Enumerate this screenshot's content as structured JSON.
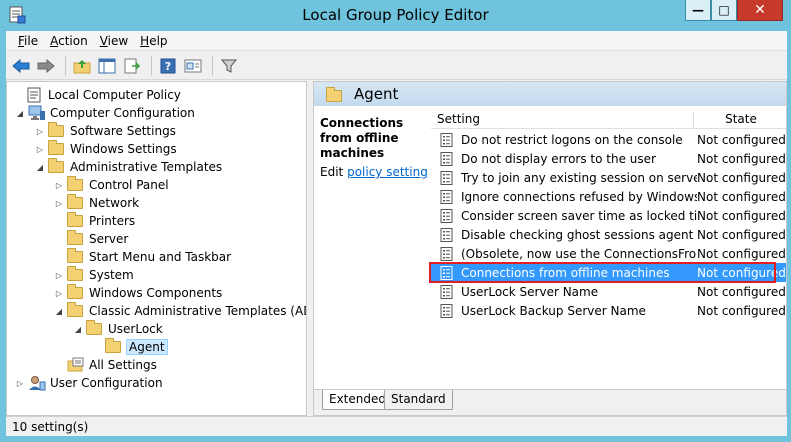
{
  "window": {
    "title": "Local Group Policy Editor"
  },
  "menu": [
    {
      "key": "F",
      "rest": "ile"
    },
    {
      "key": "A",
      "rest": "ction"
    },
    {
      "key": "V",
      "rest": "iew"
    },
    {
      "key": "H",
      "rest": "elp"
    }
  ],
  "tree": [
    {
      "label": "Local Computer Policy",
      "level": 0,
      "icon": "policy-icon",
      "exp": ""
    },
    {
      "label": "Computer Configuration",
      "level": 1,
      "icon": "computer-icon",
      "exp": "expanded"
    },
    {
      "label": "Software Settings",
      "level": 2,
      "icon": "folder-icon",
      "exp": "collapsed"
    },
    {
      "label": "Windows Settings",
      "level": 2,
      "icon": "folder-icon",
      "exp": "collapsed"
    },
    {
      "label": "Administrative Templates",
      "level": 2,
      "icon": "folder-icon",
      "exp": "expanded"
    },
    {
      "label": "Control Panel",
      "level": 3,
      "icon": "folder-icon",
      "exp": "collapsed"
    },
    {
      "label": "Network",
      "level": 3,
      "icon": "folder-icon",
      "exp": "collapsed"
    },
    {
      "label": "Printers",
      "level": 3,
      "icon": "folder-icon",
      "exp": ""
    },
    {
      "label": "Server",
      "level": 3,
      "icon": "folder-icon",
      "exp": ""
    },
    {
      "label": "Start Menu and Taskbar",
      "level": 3,
      "icon": "folder-icon",
      "exp": ""
    },
    {
      "label": "System",
      "level": 3,
      "icon": "folder-icon",
      "exp": "collapsed"
    },
    {
      "label": "Windows Components",
      "level": 3,
      "icon": "folder-icon",
      "exp": "collapsed"
    },
    {
      "label": "Classic Administrative Templates (ADM)",
      "level": 3,
      "icon": "folder-icon",
      "exp": "expanded"
    },
    {
      "label": "UserLock",
      "level": 4,
      "icon": "folder-icon",
      "exp": "expanded"
    },
    {
      "label": "Agent",
      "level": 5,
      "icon": "folder-icon",
      "exp": "",
      "selected": true
    },
    {
      "label": "All Settings",
      "level": 3,
      "icon": "all-settings-icon",
      "exp": ""
    },
    {
      "label": "User Configuration",
      "level": 1,
      "icon": "user-icon",
      "exp": "collapsed"
    }
  ],
  "right": {
    "folder_title": "Agent",
    "desc_title": "Connections from offline machines",
    "desc_edit": "Edit",
    "desc_link": "policy setting",
    "col_setting": "Setting",
    "col_state": "State",
    "rows": [
      {
        "name": "Do not restrict logons on the console",
        "state": "Not configured"
      },
      {
        "name": "Do not display errors to the user",
        "state": "Not configured"
      },
      {
        "name": "Try to join any existing session on server",
        "state": "Not configured"
      },
      {
        "name": "Ignore connections refused by Windows",
        "state": "Not configured"
      },
      {
        "name": "Consider screen saver time as locked time",
        "state": "Not configured"
      },
      {
        "name": "Disable checking ghost sessions agent side.",
        "state": "Not configured"
      },
      {
        "name": "(Obsolete, now use the ConnectionsFrom...",
        "state": "Not configured"
      },
      {
        "name": "Connections from offline machines",
        "state": "Not configured",
        "selected": true
      },
      {
        "name": "UserLock Server Name",
        "state": "Not configured"
      },
      {
        "name": "UserLock Backup Server Name",
        "state": "Not configured"
      }
    ],
    "tabs": [
      "Extended",
      "Standard"
    ]
  },
  "status": {
    "text": "10 setting(s)"
  }
}
